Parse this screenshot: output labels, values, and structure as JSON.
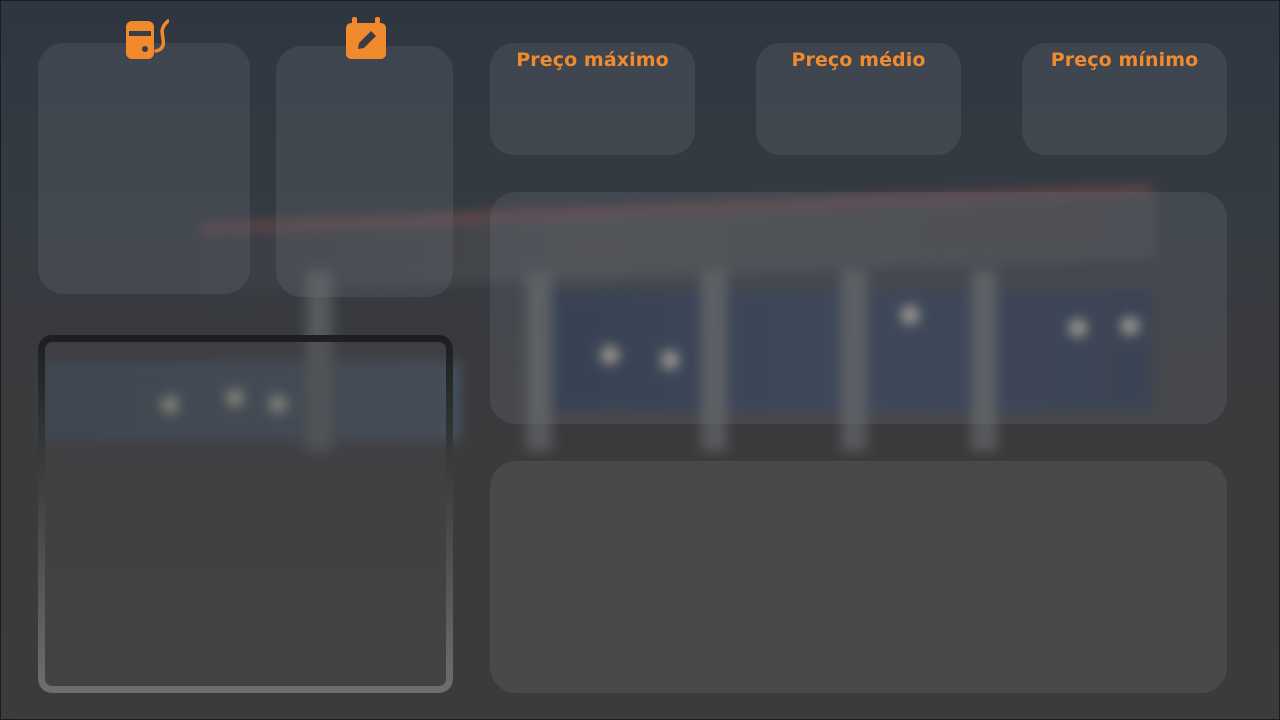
{
  "kpis": {
    "max_label": "Preço máximo",
    "avg_label": "Preço médio",
    "min_label": "Preço mínimo"
  },
  "icons": {
    "fuel": "fuel-pump-icon",
    "calendar": "calendar-edit-icon"
  },
  "colors": {
    "accent": "#f08a2c",
    "card": "rgba(120,125,132,0.22)"
  }
}
